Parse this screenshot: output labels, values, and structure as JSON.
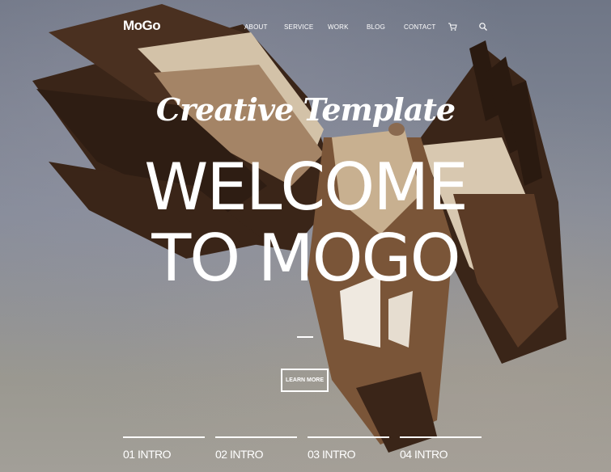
{
  "header": {
    "logo": "MoGo",
    "nav": [
      "ABOUT",
      "SERVICE",
      "WORK",
      "BLOG",
      "CONTACT"
    ],
    "icons": [
      "cart-icon",
      "search-icon"
    ]
  },
  "hero": {
    "subtitle": "Creative Template",
    "title_line1": "WELCOME",
    "title_line2": "TO MOGO",
    "button_label": "LEARN MORE"
  },
  "intro_tabs": [
    "01 INTRO",
    "02 INTRO",
    "03 INTRO",
    "04 INTRO"
  ],
  "colors": {
    "text": "#ffffff",
    "bird_dark": "#3a2518",
    "bird_mid": "#7a5538",
    "bird_light": "#d8c8b0"
  }
}
